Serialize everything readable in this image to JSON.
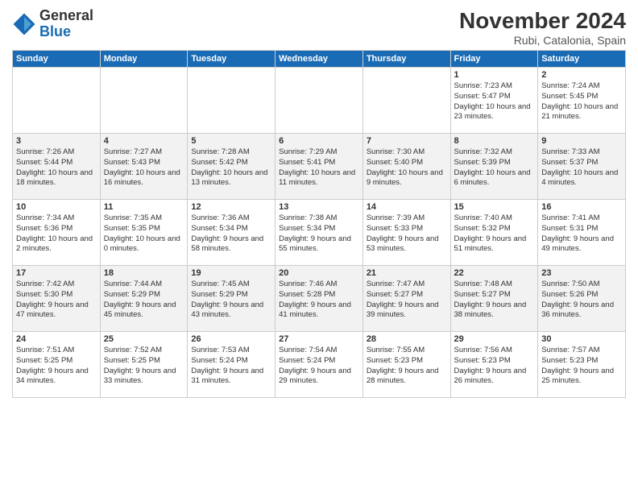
{
  "header": {
    "logo_line1": "General",
    "logo_line2": "Blue",
    "month_title": "November 2024",
    "location": "Rubi, Catalonia, Spain"
  },
  "weekdays": [
    "Sunday",
    "Monday",
    "Tuesday",
    "Wednesday",
    "Thursday",
    "Friday",
    "Saturday"
  ],
  "weeks": [
    [
      {
        "day": "",
        "content": ""
      },
      {
        "day": "",
        "content": ""
      },
      {
        "day": "",
        "content": ""
      },
      {
        "day": "",
        "content": ""
      },
      {
        "day": "",
        "content": ""
      },
      {
        "day": "1",
        "content": "Sunrise: 7:23 AM\nSunset: 5:47 PM\nDaylight: 10 hours and 23 minutes."
      },
      {
        "day": "2",
        "content": "Sunrise: 7:24 AM\nSunset: 5:45 PM\nDaylight: 10 hours and 21 minutes."
      }
    ],
    [
      {
        "day": "3",
        "content": "Sunrise: 7:26 AM\nSunset: 5:44 PM\nDaylight: 10 hours and 18 minutes."
      },
      {
        "day": "4",
        "content": "Sunrise: 7:27 AM\nSunset: 5:43 PM\nDaylight: 10 hours and 16 minutes."
      },
      {
        "day": "5",
        "content": "Sunrise: 7:28 AM\nSunset: 5:42 PM\nDaylight: 10 hours and 13 minutes."
      },
      {
        "day": "6",
        "content": "Sunrise: 7:29 AM\nSunset: 5:41 PM\nDaylight: 10 hours and 11 minutes."
      },
      {
        "day": "7",
        "content": "Sunrise: 7:30 AM\nSunset: 5:40 PM\nDaylight: 10 hours and 9 minutes."
      },
      {
        "day": "8",
        "content": "Sunrise: 7:32 AM\nSunset: 5:39 PM\nDaylight: 10 hours and 6 minutes."
      },
      {
        "day": "9",
        "content": "Sunrise: 7:33 AM\nSunset: 5:37 PM\nDaylight: 10 hours and 4 minutes."
      }
    ],
    [
      {
        "day": "10",
        "content": "Sunrise: 7:34 AM\nSunset: 5:36 PM\nDaylight: 10 hours and 2 minutes."
      },
      {
        "day": "11",
        "content": "Sunrise: 7:35 AM\nSunset: 5:35 PM\nDaylight: 10 hours and 0 minutes."
      },
      {
        "day": "12",
        "content": "Sunrise: 7:36 AM\nSunset: 5:34 PM\nDaylight: 9 hours and 58 minutes."
      },
      {
        "day": "13",
        "content": "Sunrise: 7:38 AM\nSunset: 5:34 PM\nDaylight: 9 hours and 55 minutes."
      },
      {
        "day": "14",
        "content": "Sunrise: 7:39 AM\nSunset: 5:33 PM\nDaylight: 9 hours and 53 minutes."
      },
      {
        "day": "15",
        "content": "Sunrise: 7:40 AM\nSunset: 5:32 PM\nDaylight: 9 hours and 51 minutes."
      },
      {
        "day": "16",
        "content": "Sunrise: 7:41 AM\nSunset: 5:31 PM\nDaylight: 9 hours and 49 minutes."
      }
    ],
    [
      {
        "day": "17",
        "content": "Sunrise: 7:42 AM\nSunset: 5:30 PM\nDaylight: 9 hours and 47 minutes."
      },
      {
        "day": "18",
        "content": "Sunrise: 7:44 AM\nSunset: 5:29 PM\nDaylight: 9 hours and 45 minutes."
      },
      {
        "day": "19",
        "content": "Sunrise: 7:45 AM\nSunset: 5:29 PM\nDaylight: 9 hours and 43 minutes."
      },
      {
        "day": "20",
        "content": "Sunrise: 7:46 AM\nSunset: 5:28 PM\nDaylight: 9 hours and 41 minutes."
      },
      {
        "day": "21",
        "content": "Sunrise: 7:47 AM\nSunset: 5:27 PM\nDaylight: 9 hours and 39 minutes."
      },
      {
        "day": "22",
        "content": "Sunrise: 7:48 AM\nSunset: 5:27 PM\nDaylight: 9 hours and 38 minutes."
      },
      {
        "day": "23",
        "content": "Sunrise: 7:50 AM\nSunset: 5:26 PM\nDaylight: 9 hours and 36 minutes."
      }
    ],
    [
      {
        "day": "24",
        "content": "Sunrise: 7:51 AM\nSunset: 5:25 PM\nDaylight: 9 hours and 34 minutes."
      },
      {
        "day": "25",
        "content": "Sunrise: 7:52 AM\nSunset: 5:25 PM\nDaylight: 9 hours and 33 minutes."
      },
      {
        "day": "26",
        "content": "Sunrise: 7:53 AM\nSunset: 5:24 PM\nDaylight: 9 hours and 31 minutes."
      },
      {
        "day": "27",
        "content": "Sunrise: 7:54 AM\nSunset: 5:24 PM\nDaylight: 9 hours and 29 minutes."
      },
      {
        "day": "28",
        "content": "Sunrise: 7:55 AM\nSunset: 5:23 PM\nDaylight: 9 hours and 28 minutes."
      },
      {
        "day": "29",
        "content": "Sunrise: 7:56 AM\nSunset: 5:23 PM\nDaylight: 9 hours and 26 minutes."
      },
      {
        "day": "30",
        "content": "Sunrise: 7:57 AM\nSunset: 5:23 PM\nDaylight: 9 hours and 25 minutes."
      }
    ]
  ]
}
